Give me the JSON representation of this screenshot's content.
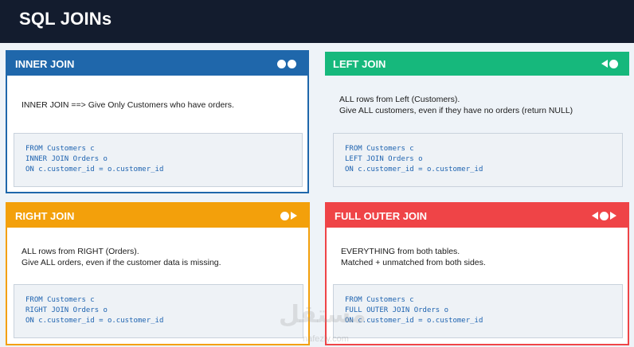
{
  "header": {
    "title": "SQL JOINs"
  },
  "cards": [
    {
      "title": "INNER JOIN",
      "desc1": "INNER JOIN ==> Give Only Customers who have orders.",
      "desc2": "",
      "code": [
        "FROM Customers c",
        "INNER JOIN Orders o",
        "ON c.customer_id = o.customer_id"
      ],
      "icon": "two-circles-icon"
    },
    {
      "title": "LEFT JOIN",
      "desc1": "ALL rows from Left (Customers).",
      "desc2": "Give ALL customers, even if they have no orders (return NULL)",
      "code": [
        "FROM Customers c",
        "LEFT JOIN Orders o",
        "ON c.customer_id = o.customer_id"
      ],
      "icon": "left-arrow-circle-icon"
    },
    {
      "title": "RIGHT JOIN",
      "desc1": "ALL rows from RIGHT (Orders).",
      "desc2": "Give ALL orders, even if the customer data is missing.",
      "code": [
        "FROM Customers c",
        "RIGHT JOIN Orders o",
        "ON c.customer_id = o.customer_id"
      ],
      "icon": "circle-right-arrow-icon"
    },
    {
      "title": "FULL OUTER JOIN",
      "desc1": "EVERYTHING from both tables.",
      "desc2": "Matched + unmatched from both sides.",
      "code": [
        "FROM Customers c",
        "FULL OUTER JOIN Orders o",
        "ON c.customer_id = o.customer_id"
      ],
      "icon": "both-arrows-circle-icon"
    }
  ],
  "watermark": {
    "text": "مستقل",
    "sub": "nafezly.com"
  },
  "colors": {
    "inner": "#1f67ab",
    "left": "#16b87c",
    "right": "#f3a00b",
    "full": "#ef4447",
    "topbar": "#131c2e"
  }
}
